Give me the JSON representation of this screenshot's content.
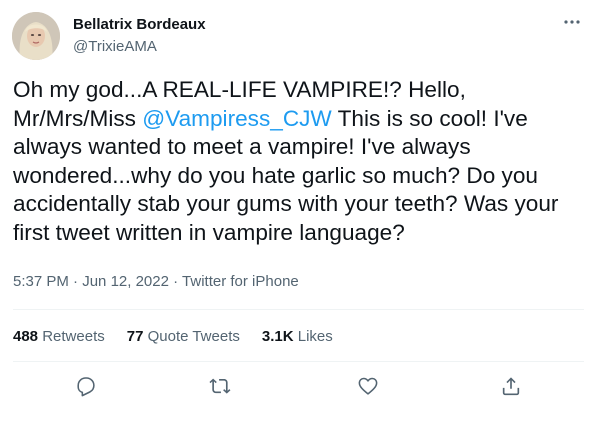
{
  "author": {
    "display_name": "Bellatrix Bordeaux",
    "handle": "@TrixieAMA"
  },
  "tweet": {
    "text_part1": "Oh my god...A REAL-LIFE VAMPIRE!? Hello, Mr/Mrs/Miss ",
    "mention": "@Vampiress_CJW",
    "text_part2": " This is so cool! I've always wanted to meet a vampire! I've always wondered...why do you hate garlic so much? Do you accidentally stab your gums with your teeth? Was your first tweet written in vampire language?",
    "time": "5:37 PM",
    "separator": " · ",
    "date": "Jun 12, 2022",
    "source": "Twitter for iPhone"
  },
  "stats": {
    "retweets_count": "488",
    "retweets_label": "Retweets",
    "quotes_count": "77",
    "quotes_label": "Quote Tweets",
    "likes_count": "3.1K",
    "likes_label": "Likes"
  },
  "icons": {
    "more": "more-horizontal-icon",
    "reply": "reply-icon",
    "retweet": "retweet-icon",
    "like": "heart-icon",
    "share": "share-icon"
  },
  "colors": {
    "link": "#1d9bf0",
    "secondary_text": "#536471",
    "primary_text": "#0f1419",
    "divider": "#eff3f4"
  }
}
